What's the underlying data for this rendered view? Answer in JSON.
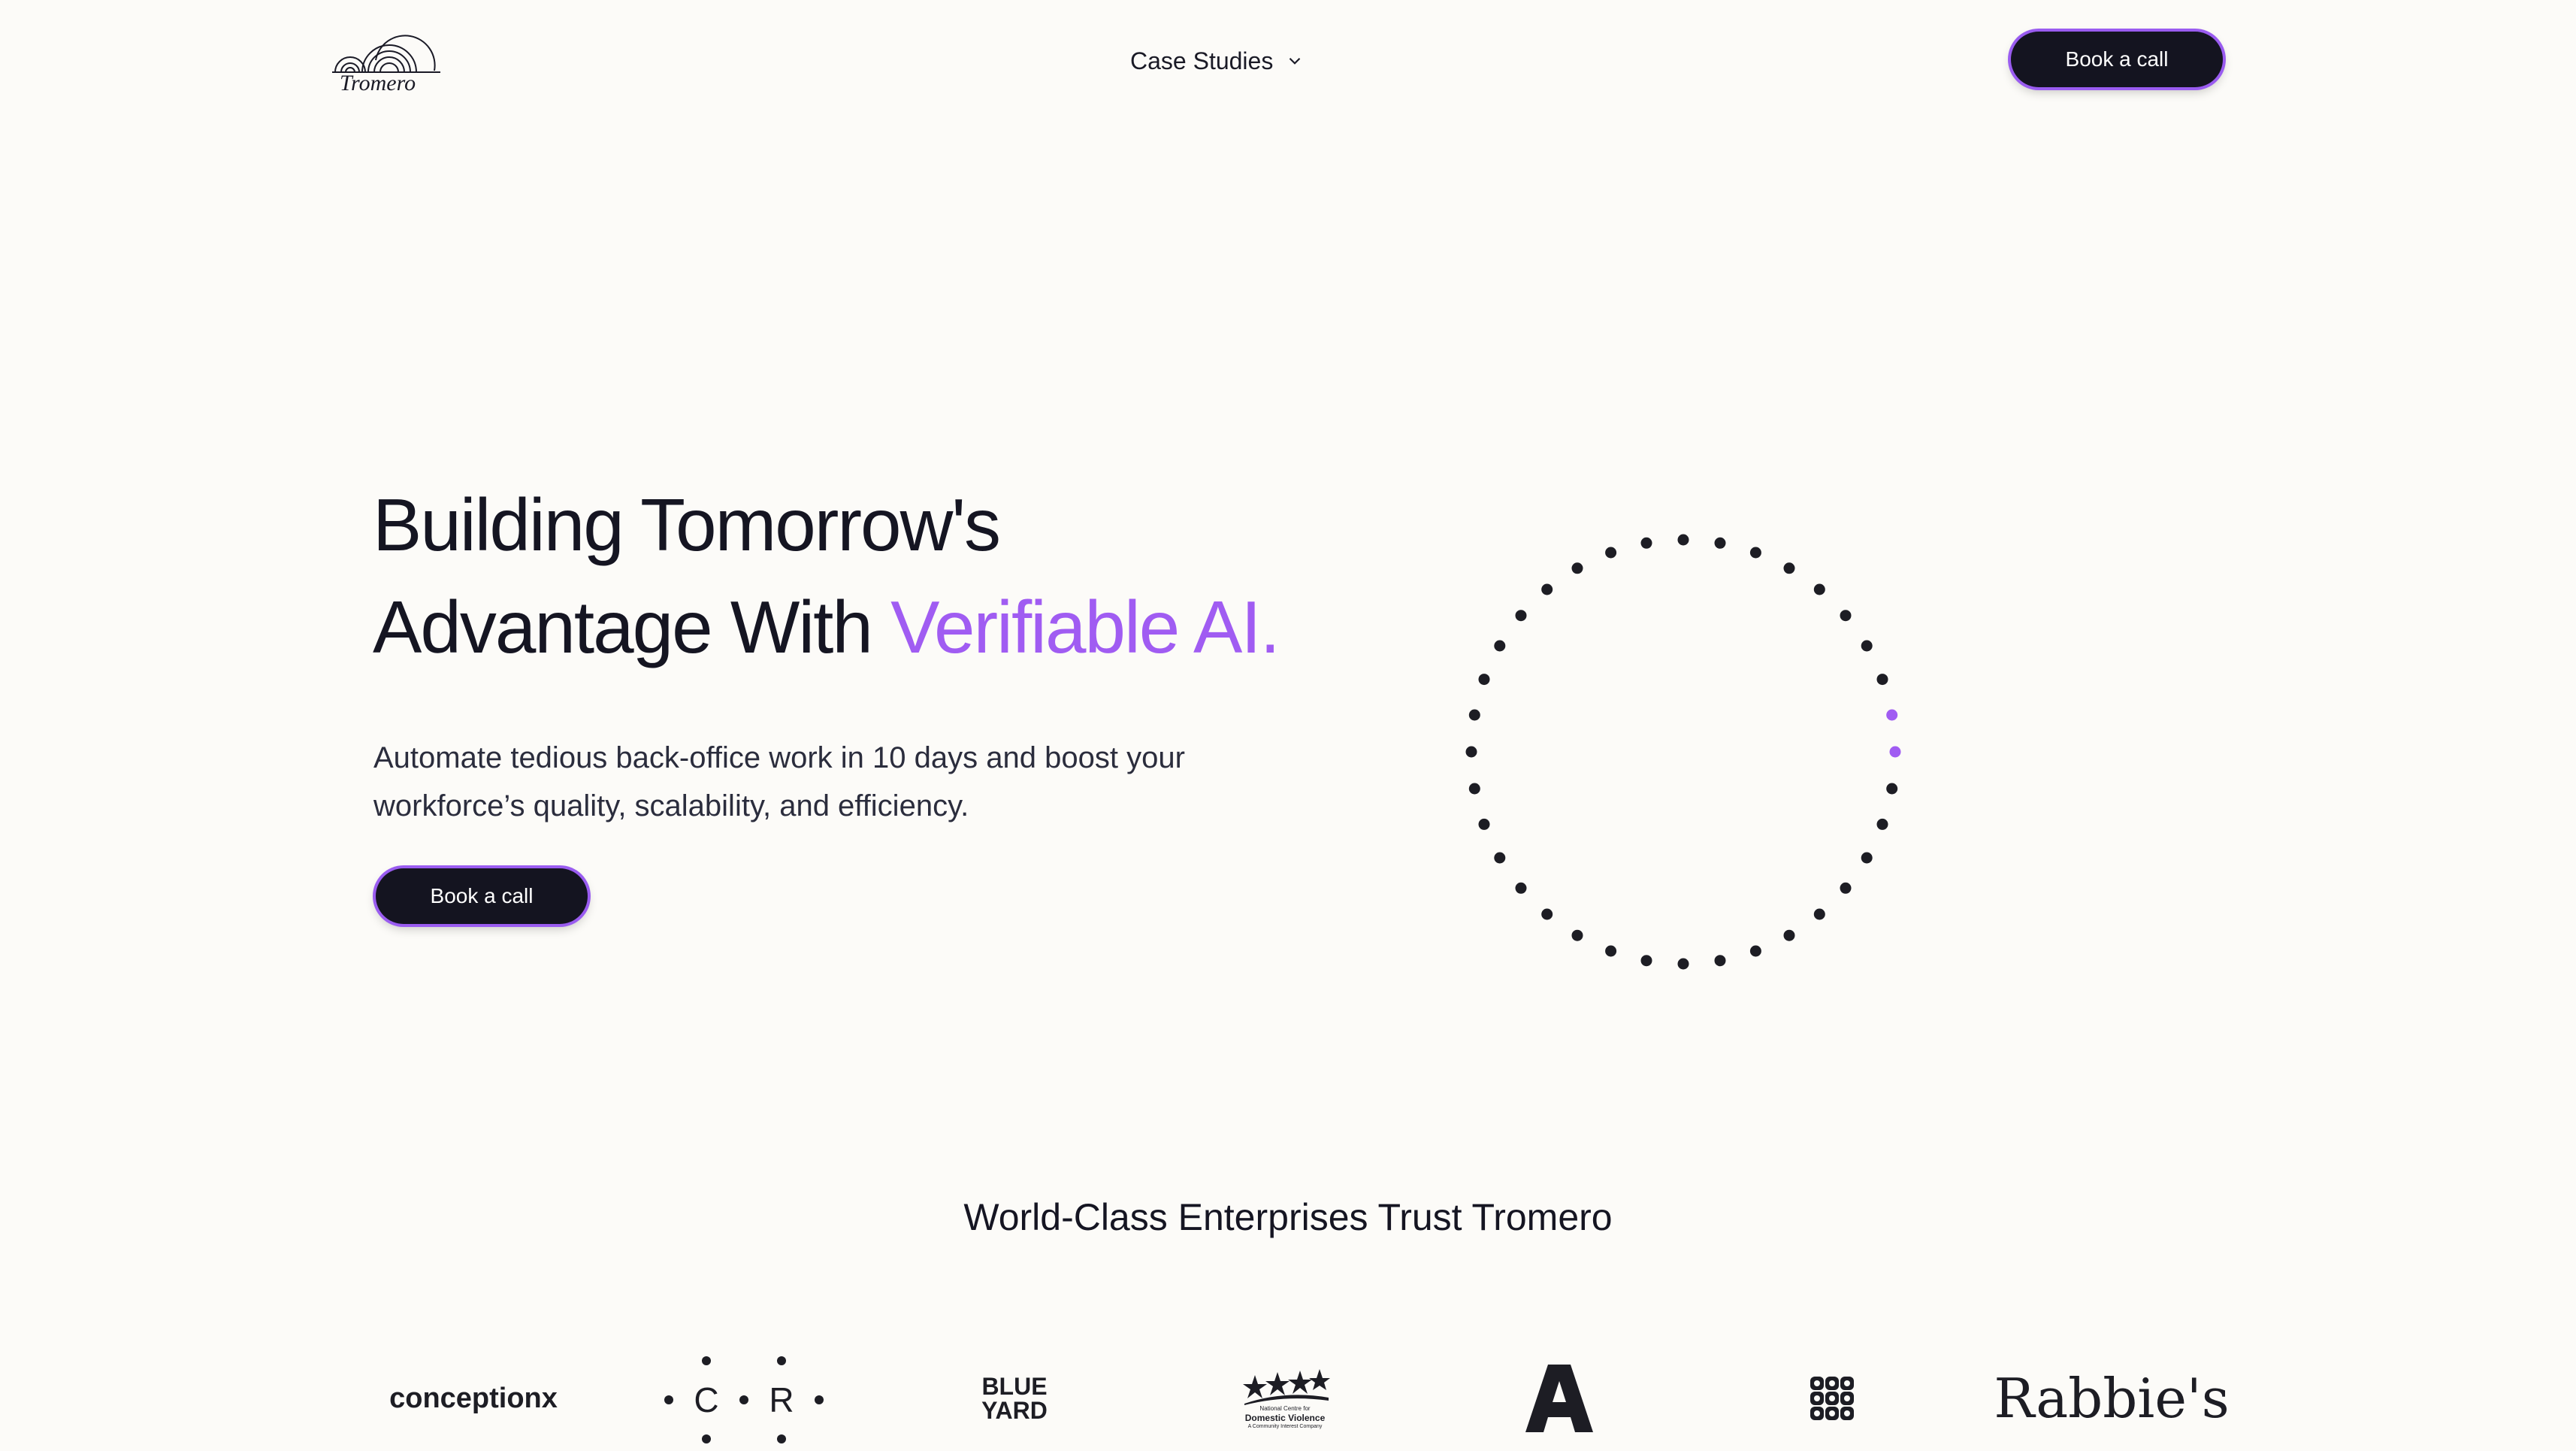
{
  "header": {
    "logo_text": "Tromero",
    "nav_case_studies": "Case Studies",
    "book_label": "Book a call"
  },
  "hero": {
    "title_line1": "Building Tomorrow's",
    "title_line2_prefix": "Advantage With ",
    "title_accent": "Verifiable AI.",
    "subtitle": "Automate tedious back-office work in 10 days and boost your workforce’s quality, scalability, and efficiency.",
    "book_label": "Book a call"
  },
  "trust": {
    "heading": "World-Class Enterprises Trust Tromero",
    "logos": {
      "conceptionx": "conceptionx",
      "cr_c": "C",
      "cr_r": "R",
      "blueyard_line1": "BLUE",
      "blueyard_line2": "YARD",
      "ncdv_line1": "National Centre for",
      "ncdv_line2": "Domestic Violence",
      "ncdv_line3": "A Community Interest Company",
      "rabbies": "Rabbie's"
    }
  },
  "colors": {
    "accent": "#a05cf2",
    "dark": "#141420",
    "background": "#fcfbf8"
  },
  "icons": {
    "nav_chevron": "chevron-down-icon",
    "loader": "dot-ring-loader"
  }
}
